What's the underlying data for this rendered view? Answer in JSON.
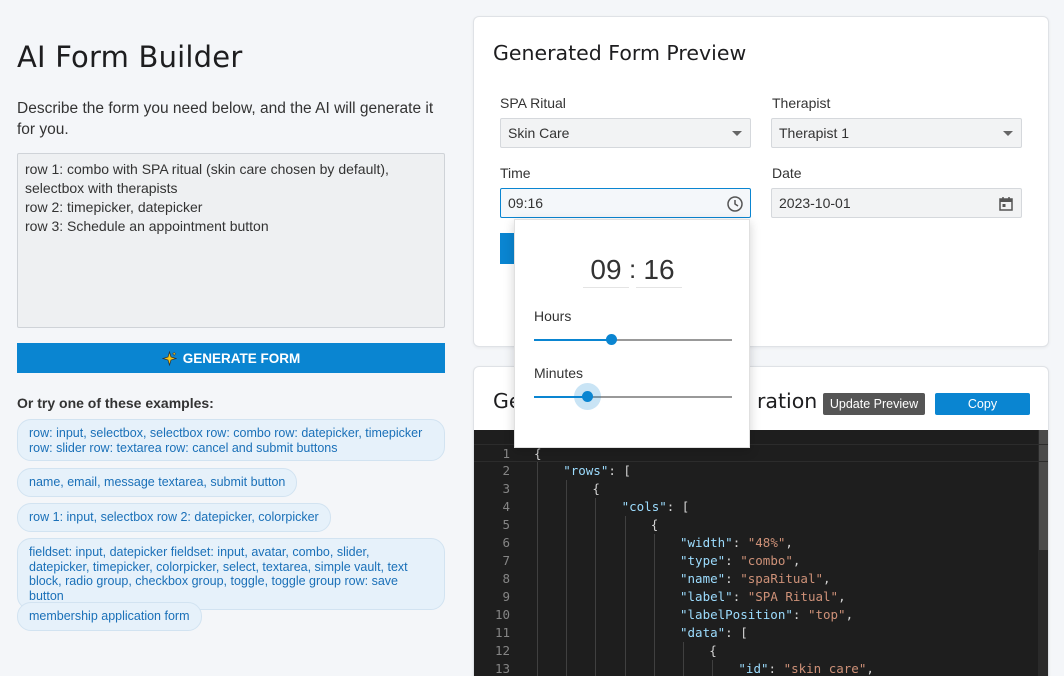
{
  "app": {
    "title": "AI Form Builder",
    "description": "Describe the form you need below, and the AI will generate it for you.",
    "prompt_value": "row 1: combo with SPA ritual (skin care chosen by default), selectbox with therapists\nrow 2: timepicker, datepicker\nrow 3: Schedule an appointment button",
    "generate_label": "GENERATE FORM",
    "examples_title": "Or try one of these examples:",
    "examples": [
      "row: input, selectbox, selectbox row: combo row: datepicker, timepicker row: slider row: textarea row: cancel and submit buttons",
      "name, email, message textarea, submit button",
      "row 1: input, selectbox row 2: datepicker, colorpicker",
      "fieldset: input, datepicker fieldset: input, avatar, combo, slider, datepicker, timepicker, colorpicker, select, textarea, simple vault, text block, radio group, checkbox group, toggle, toggle group row: save button",
      "membership application form"
    ]
  },
  "preview": {
    "title": "Generated Form Preview",
    "spa_label": "SPA Ritual",
    "spa_value": "Skin Care",
    "therapist_label": "Therapist",
    "therapist_value": "Therapist 1",
    "time_label": "Time",
    "time_value": "09:16",
    "date_label": "Date",
    "date_value": "2023-10-01",
    "timepicker": {
      "hours": "09",
      "minutes": "16",
      "hours_label": "Hours",
      "minutes_label": "Minutes",
      "hours_fraction": 0.39,
      "minutes_fraction": 0.27
    }
  },
  "config": {
    "title_left": "Ge",
    "title_right": "ration",
    "update_label": "Update Preview",
    "copy_label": "Copy",
    "code_lines": [
      {
        "n": "1",
        "indent": 0,
        "parts": [
          [
            "p",
            "{"
          ]
        ]
      },
      {
        "n": "2",
        "indent": 1,
        "parts": [
          [
            "k",
            "\"rows\""
          ],
          [
            "p",
            ": ["
          ]
        ]
      },
      {
        "n": "3",
        "indent": 2,
        "parts": [
          [
            "p",
            "{"
          ]
        ]
      },
      {
        "n": "4",
        "indent": 3,
        "parts": [
          [
            "k",
            "\"cols\""
          ],
          [
            "p",
            ": ["
          ]
        ]
      },
      {
        "n": "5",
        "indent": 4,
        "parts": [
          [
            "p",
            "{"
          ]
        ]
      },
      {
        "n": "6",
        "indent": 5,
        "parts": [
          [
            "k",
            "\"width\""
          ],
          [
            "p",
            ": "
          ],
          [
            "s",
            "\"48%\""
          ],
          [
            "p",
            ","
          ]
        ]
      },
      {
        "n": "7",
        "indent": 5,
        "parts": [
          [
            "k",
            "\"type\""
          ],
          [
            "p",
            ": "
          ],
          [
            "s",
            "\"combo\""
          ],
          [
            "p",
            ","
          ]
        ]
      },
      {
        "n": "8",
        "indent": 5,
        "parts": [
          [
            "k",
            "\"name\""
          ],
          [
            "p",
            ": "
          ],
          [
            "s",
            "\"spaRitual\""
          ],
          [
            "p",
            ","
          ]
        ]
      },
      {
        "n": "9",
        "indent": 5,
        "parts": [
          [
            "k",
            "\"label\""
          ],
          [
            "p",
            ": "
          ],
          [
            "s",
            "\"SPA Ritual\""
          ],
          [
            "p",
            ","
          ]
        ]
      },
      {
        "n": "10",
        "indent": 5,
        "parts": [
          [
            "k",
            "\"labelPosition\""
          ],
          [
            "p",
            ": "
          ],
          [
            "s",
            "\"top\""
          ],
          [
            "p",
            ","
          ]
        ]
      },
      {
        "n": "11",
        "indent": 5,
        "parts": [
          [
            "k",
            "\"data\""
          ],
          [
            "p",
            ": ["
          ]
        ]
      },
      {
        "n": "12",
        "indent": 6,
        "parts": [
          [
            "p",
            "{"
          ]
        ]
      },
      {
        "n": "13",
        "indent": 7,
        "parts": [
          [
            "k",
            "\"id\""
          ],
          [
            "p",
            ": "
          ],
          [
            "s",
            "\"skin care\""
          ],
          [
            "p",
            ","
          ]
        ]
      }
    ]
  },
  "colors": {
    "accent": "#0a85d1",
    "editor_bg": "#1e1e1e",
    "json_key": "#9cdcfe",
    "json_string": "#ce9178"
  }
}
